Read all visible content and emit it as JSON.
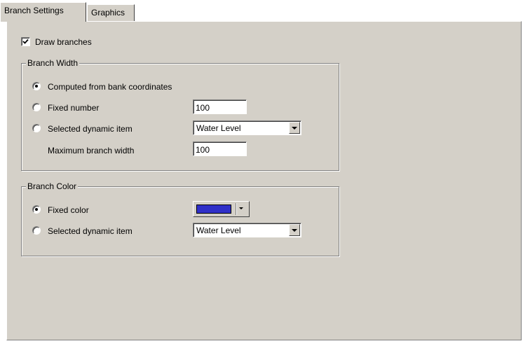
{
  "tabs": [
    {
      "label": "Branch Settings",
      "active": true
    },
    {
      "label": "Graphics",
      "active": false
    }
  ],
  "draw_branches": {
    "label": "Draw branches",
    "checked": true
  },
  "branch_width": {
    "legend": "Branch Width",
    "options": [
      {
        "label": "Computed from bank coordinates",
        "selected": true
      },
      {
        "label": "Fixed number",
        "selected": false
      },
      {
        "label": "Selected dynamic item",
        "selected": false
      }
    ],
    "fixed_number_value": "100",
    "dynamic_item_value": "Water Level",
    "max_width_label": "Maximum branch width",
    "max_width_value": "100"
  },
  "branch_color": {
    "legend": "Branch Color",
    "options": [
      {
        "label": "Fixed color",
        "selected": true
      },
      {
        "label": "Selected dynamic item",
        "selected": false
      }
    ],
    "fixed_color": "#3030c8",
    "dynamic_item_value": "Water Level"
  },
  "icons": {
    "checkbox_mark": "check-icon",
    "dropdown": "chevron-down-icon"
  }
}
